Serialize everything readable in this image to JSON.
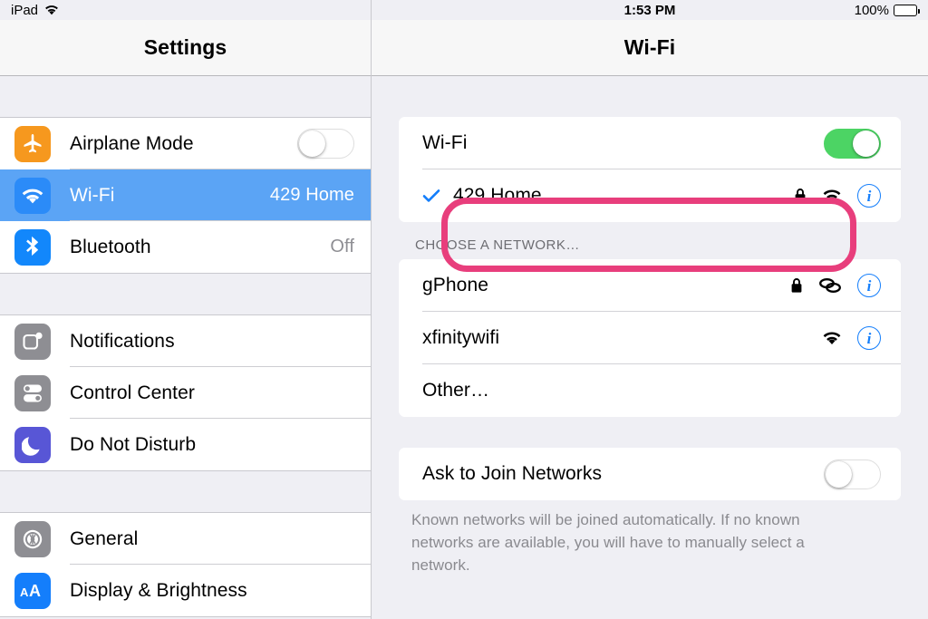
{
  "status_bar": {
    "device_label": "iPad",
    "wifi_icon": "wifi-icon",
    "time": "1:53 PM",
    "battery_percent": "100%",
    "battery_icon": "battery-full-icon"
  },
  "sidebar": {
    "title": "Settings",
    "groups": [
      {
        "items": [
          {
            "label": "Airplane Mode",
            "icon": "airplane-icon",
            "icon_class": "ic-airplane",
            "control": "toggle",
            "toggle_on": false,
            "selected": false
          },
          {
            "label": "Wi-Fi",
            "icon": "wifi-icon",
            "icon_class": "ic-wifi",
            "control": "value",
            "value": "429 Home",
            "selected": true
          },
          {
            "label": "Bluetooth",
            "icon": "bluetooth-icon",
            "icon_class": "ic-bluetooth",
            "control": "value",
            "value": "Off",
            "selected": false
          }
        ]
      },
      {
        "items": [
          {
            "label": "Notifications",
            "icon": "notifications-icon",
            "icon_class": "ic-notif",
            "control": "none",
            "selected": false
          },
          {
            "label": "Control Center",
            "icon": "control-center-icon",
            "icon_class": "ic-control",
            "control": "none",
            "selected": false
          },
          {
            "label": "Do Not Disturb",
            "icon": "moon-icon",
            "icon_class": "ic-dnd",
            "control": "none",
            "selected": false
          }
        ]
      },
      {
        "items": [
          {
            "label": "General",
            "icon": "gear-icon",
            "icon_class": "ic-general",
            "control": "none",
            "selected": false
          },
          {
            "label": "Display & Brightness",
            "icon": "text-size-icon",
            "icon_class": "ic-display",
            "control": "none",
            "selected": false
          }
        ]
      }
    ]
  },
  "detail": {
    "title": "Wi-Fi",
    "wifi_toggle": {
      "label": "Wi-Fi",
      "on": true
    },
    "connected_network": {
      "name": "429 Home",
      "checked": true,
      "secure": true,
      "signal_icon": "wifi-icon",
      "info_label": "i"
    },
    "section_header": "CHOOSE A NETWORK…",
    "networks": [
      {
        "name": "gPhone",
        "secure": true,
        "signal_icon": "personal-hotspot-icon",
        "info_label": "i",
        "highlighted": true
      },
      {
        "name": "xfinitywifi",
        "secure": false,
        "signal_icon": "wifi-icon",
        "info_label": "i",
        "highlighted": false
      }
    ],
    "other_row": {
      "name": "Other…"
    },
    "ask_to_join": {
      "label": "Ask to Join Networks",
      "on": false
    },
    "footnote": "Known networks will be joined automatically. If no known networks are available, you will have to manually select a network."
  },
  "annotation": {
    "shape": "rounded-rectangle",
    "color": "#E83E7C",
    "target": "gPhone"
  },
  "colors": {
    "selected_row": "#5BA4F5",
    "toggle_on": "#4CD464",
    "accent_blue": "#147EFB",
    "annotation_pink": "#E83E7C",
    "background": "#EFEFF4"
  }
}
